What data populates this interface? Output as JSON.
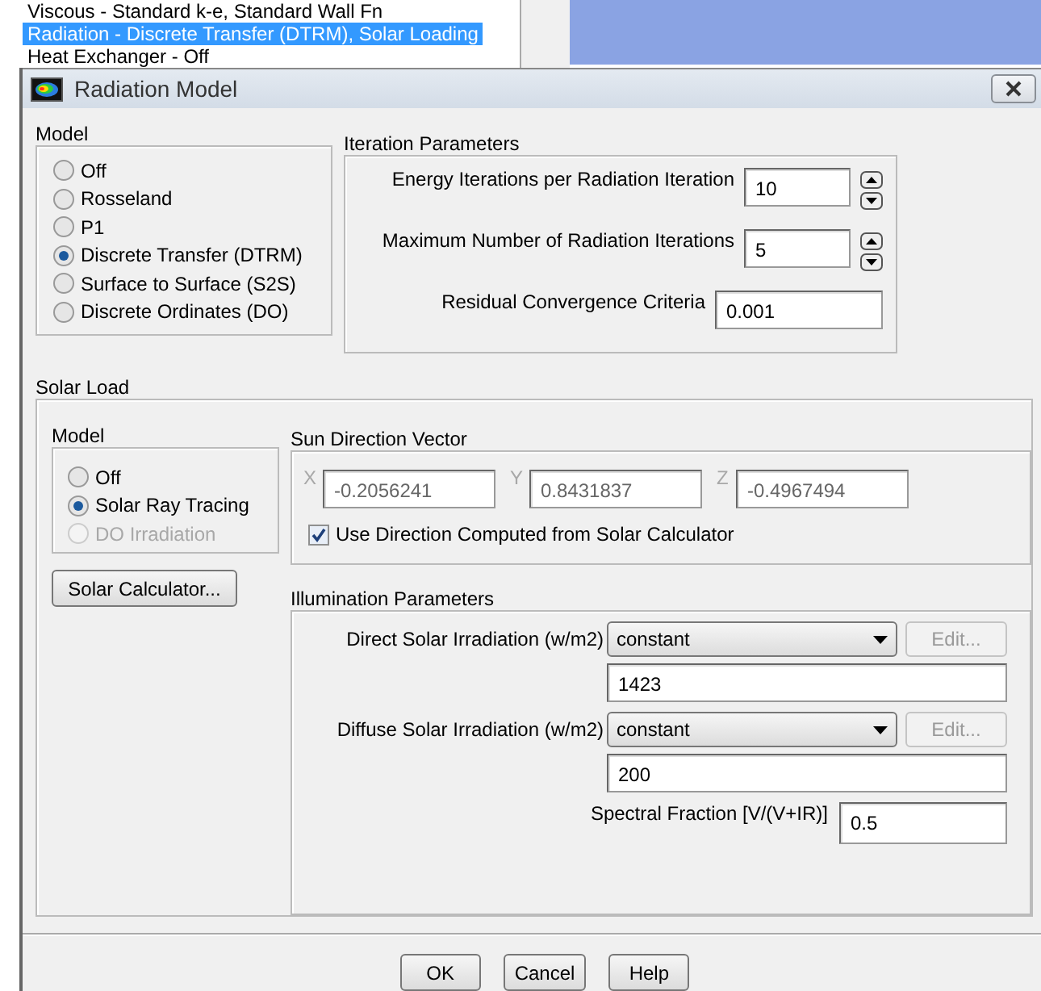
{
  "background_list": {
    "items": [
      {
        "label": "Viscous - Standard k-e, Standard Wall Fn",
        "selected": false
      },
      {
        "label": "Radiation - Discrete Transfer (DTRM), Solar Loading",
        "selected": true
      },
      {
        "label": "Heat Exchanger - Off",
        "selected": false
      }
    ]
  },
  "window": {
    "title": "Radiation Model"
  },
  "model": {
    "title": "Model",
    "options": [
      {
        "label": "Off",
        "selected": false
      },
      {
        "label": "Rosseland",
        "selected": false
      },
      {
        "label": "P1",
        "selected": false
      },
      {
        "label": "Discrete Transfer (DTRM)",
        "selected": true
      },
      {
        "label": "Surface to Surface (S2S)",
        "selected": false
      },
      {
        "label": "Discrete Ordinates (DO)",
        "selected": false
      }
    ]
  },
  "iteration_parameters": {
    "title": "Iteration Parameters",
    "fields": [
      {
        "kind": "spinner",
        "label": "Energy Iterations per Radiation Iteration",
        "value": "10"
      },
      {
        "kind": "spinner",
        "label": "Maximum Number of Radiation Iterations",
        "value": "5"
      },
      {
        "kind": "text",
        "label": "Residual Convergence Criteria",
        "value": "0.001"
      }
    ]
  },
  "solar_load": {
    "title": "Solar Load",
    "model": {
      "title": "Model",
      "options": [
        {
          "label": "Off",
          "selected": false,
          "disabled": false
        },
        {
          "label": "Solar Ray Tracing",
          "selected": true,
          "disabled": false
        },
        {
          "label": "DO Irradiation",
          "selected": false,
          "disabled": true
        }
      ]
    },
    "solar_calculator_button": "Solar Calculator...",
    "sun_direction_vector": {
      "title": "Sun Direction Vector",
      "components": [
        {
          "axis": "X",
          "value": "-0.2056241",
          "disabled": true
        },
        {
          "axis": "Y",
          "value": "0.8431837",
          "disabled": true
        },
        {
          "axis": "Z",
          "value": "-0.4967494",
          "disabled": true
        }
      ],
      "use_computed": {
        "label": "Use Direction Computed from Solar Calculator",
        "checked": true
      }
    },
    "illumination_parameters": {
      "title": "Illumination Parameters",
      "rows": [
        {
          "label": "Direct Solar Irradiation (w/m2)",
          "method": "constant",
          "edit_button": "Edit...",
          "edit_disabled": true,
          "value": "1423"
        },
        {
          "label": "Diffuse Solar Irradiation (w/m2)",
          "method": "constant",
          "edit_button": "Edit...",
          "edit_disabled": true,
          "value": "200"
        }
      ],
      "spectral_fraction": {
        "label": "Spectral Fraction [V/(V+IR)]",
        "value": "0.5"
      }
    }
  },
  "buttons": [
    "OK",
    "Cancel",
    "Help"
  ]
}
